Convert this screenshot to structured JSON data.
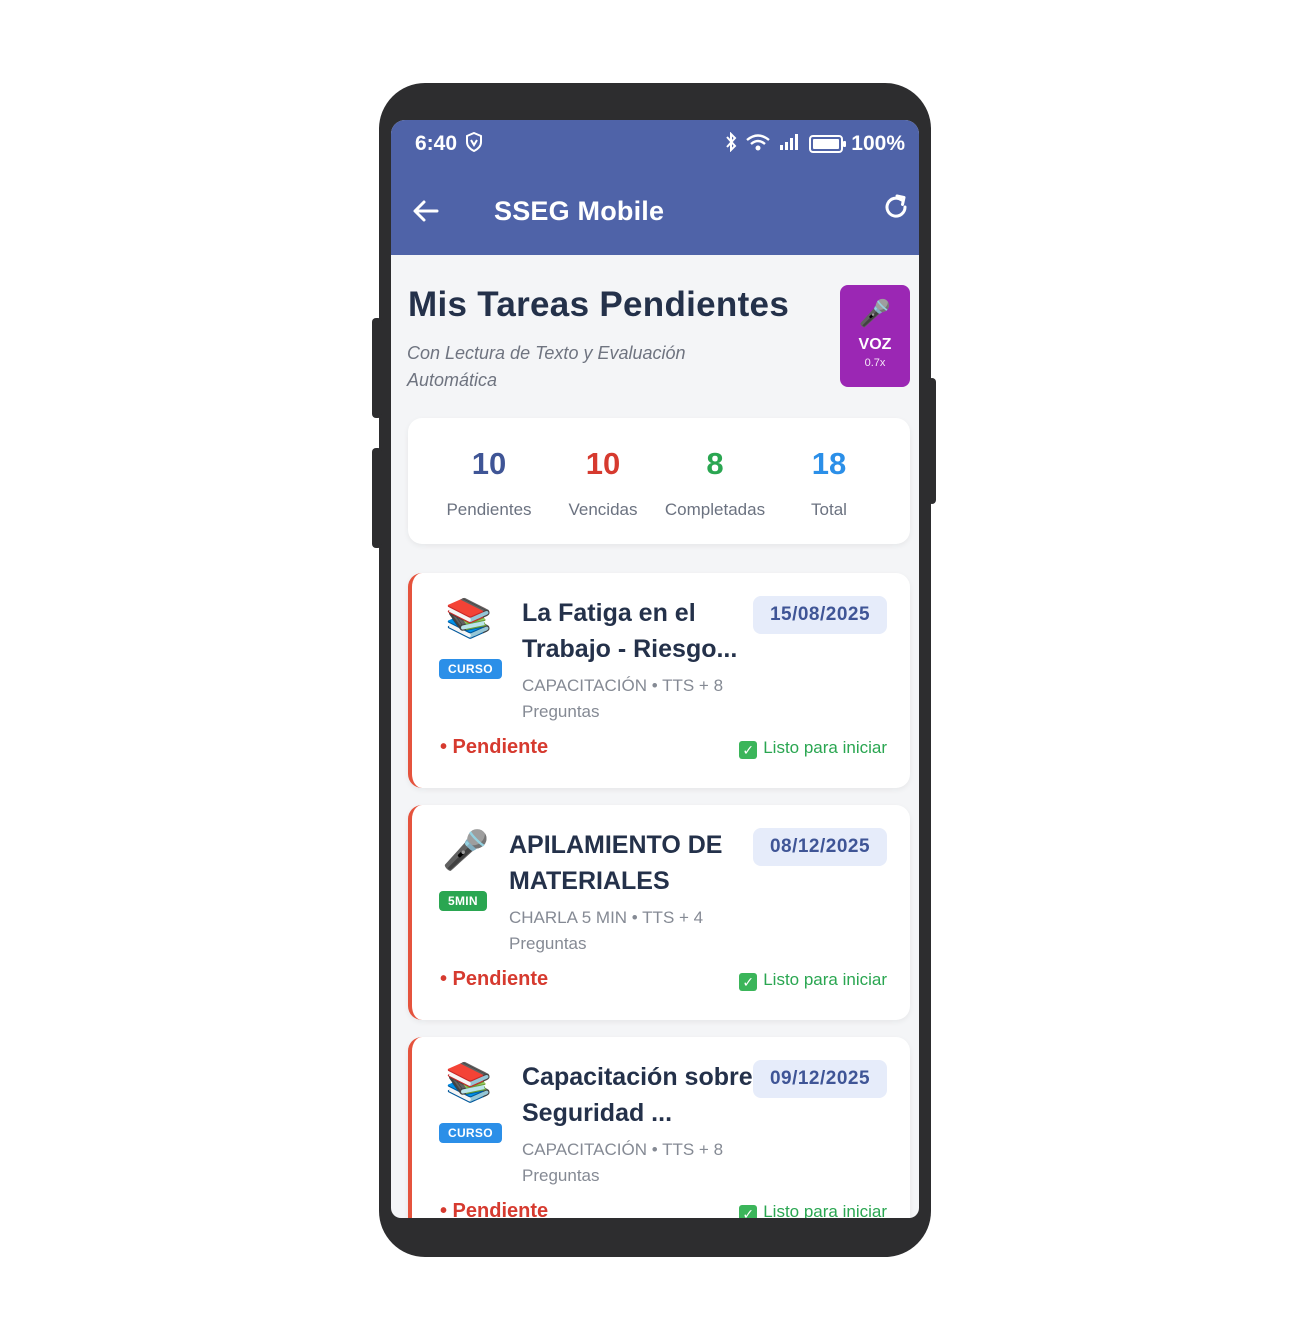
{
  "status_bar": {
    "time": "6:40",
    "battery": "100%",
    "battery_level": 1.0,
    "icons": [
      "shield-icon",
      "bluetooth-icon",
      "wifi-icon",
      "signal-icon",
      "battery-icon"
    ]
  },
  "app_bar": {
    "title": "SSEG Mobile",
    "back_icon": "arrow-left-icon",
    "refresh_icon": "refresh-icon",
    "color": "#4f63a8"
  },
  "header": {
    "title": "Mis Tareas Pendientes",
    "subtitle": "Con Lectura de Texto y Evaluación Automática"
  },
  "voice_button": {
    "icon": "microphone-icon",
    "label": "VOZ",
    "speed": "0.7x",
    "color": "#9b27b4"
  },
  "stats": [
    {
      "value": "10",
      "label": "Pendientes",
      "color": "#3f5596"
    },
    {
      "value": "10",
      "label": "Vencidas",
      "color": "#d63a2f"
    },
    {
      "value": "8",
      "label": "Completadas",
      "color": "#2aa651"
    },
    {
      "value": "18",
      "label": "Total",
      "color": "#2b8fe8"
    }
  ],
  "tasks": [
    {
      "icon": "books-icon",
      "badge": "CURSO",
      "title": "La Fatiga en el Trabajo - Riesgo...",
      "meta": "CAPACITACIÓN • TTS + 8 Preguntas",
      "date": "15/08/2025",
      "status": "• Pendiente",
      "ready": "Listo para iniciar"
    },
    {
      "icon": "microphone-icon",
      "badge": "5MIN",
      "title": "APILAMIENTO DE MATERIALES",
      "meta": "CHARLA 5 MIN • TTS + 4 Preguntas",
      "date": "08/12/2025",
      "status": "• Pendiente",
      "ready": "Listo para iniciar"
    },
    {
      "icon": "books-icon",
      "badge": "CURSO",
      "title": "Capacitación sobre Seguridad ...",
      "meta": "CAPACITACIÓN • TTS + 8 Preguntas",
      "date": "09/12/2025",
      "status": "• Pendiente",
      "ready": "Listo para iniciar"
    }
  ],
  "colors": {
    "overdue_border": "#e5533d",
    "pending_text": "#d63a2f",
    "ready_text": "#2aa651",
    "date_chip_bg": "#e6ecfa"
  }
}
